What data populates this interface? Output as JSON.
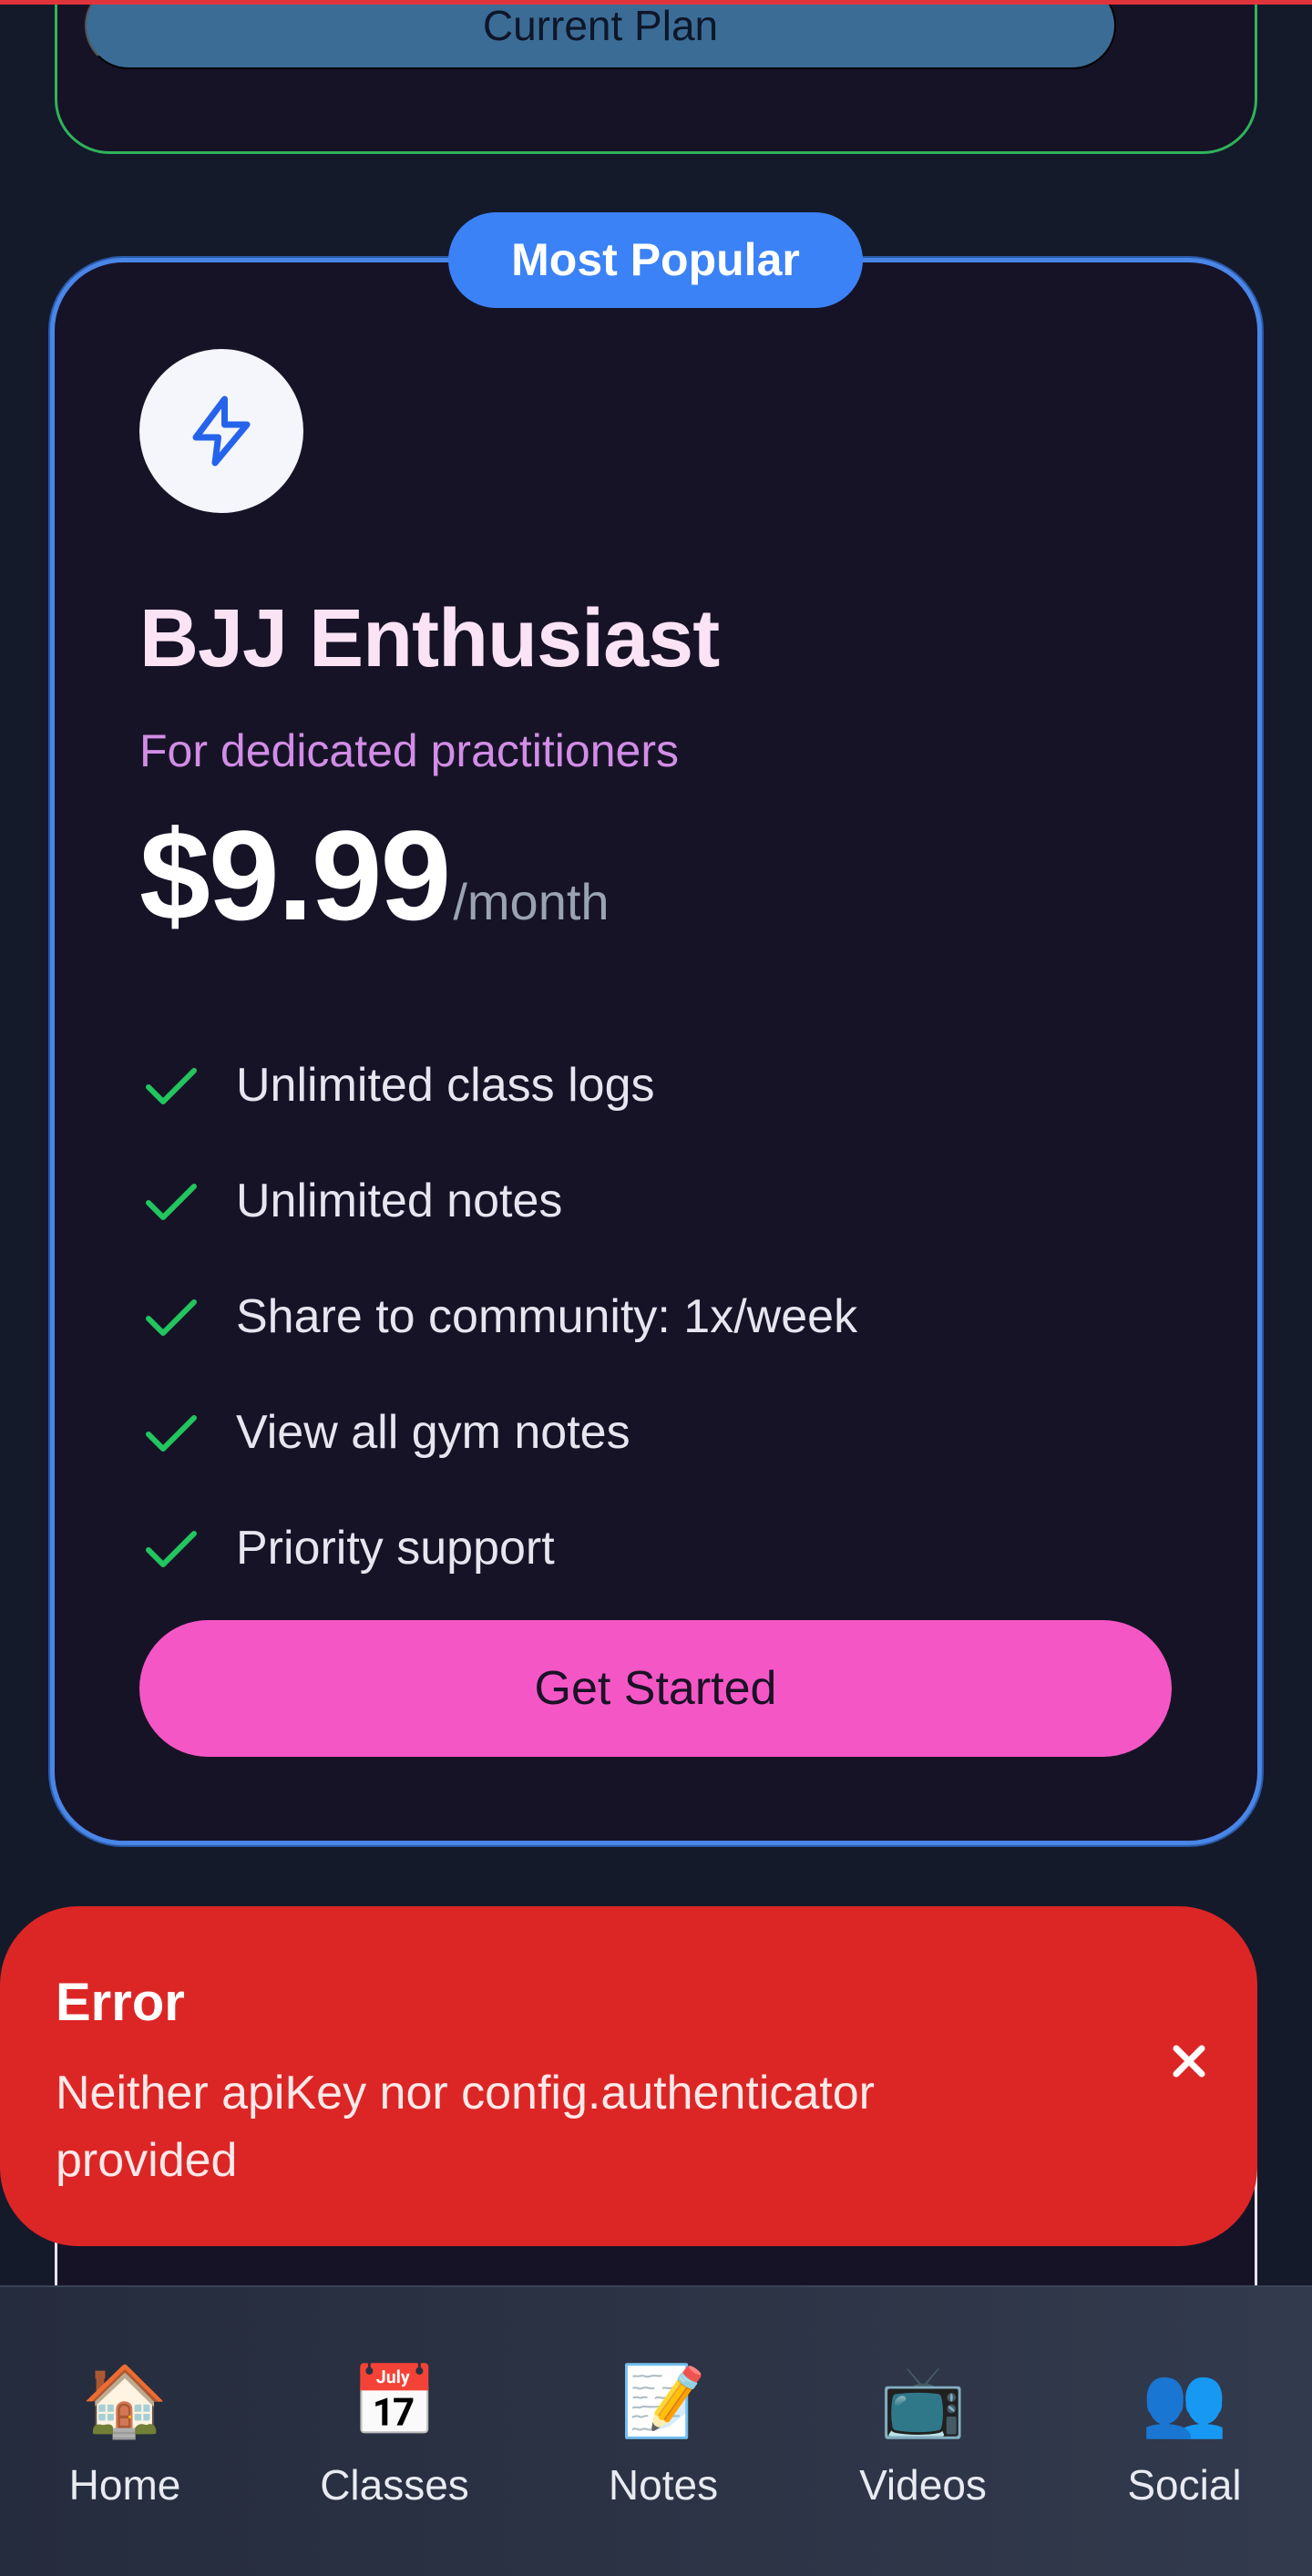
{
  "previous_plan": {
    "button_label": "Current Plan"
  },
  "plan": {
    "badge": "Most Popular",
    "icon": "lightning-bolt-icon",
    "title": "BJJ Enthusiast",
    "subtitle": "For dedicated practitioners",
    "price": "$9.99",
    "period": "/month",
    "features": [
      "Unlimited class logs",
      "Unlimited notes",
      "Share to community: 1x/week",
      "View all gym notes",
      "Priority support"
    ],
    "cta_label": "Get Started"
  },
  "toast": {
    "title": "Error",
    "message": "Neither apiKey nor config.authenticator provided",
    "close_icon": "close-icon"
  },
  "nav": {
    "items": [
      {
        "label": "Home",
        "icon": "🏠",
        "icon_name": "house-icon"
      },
      {
        "label": "Classes",
        "icon": "📅",
        "icon_name": "calendar-icon"
      },
      {
        "label": "Notes",
        "icon": "📝",
        "icon_name": "memo-icon"
      },
      {
        "label": "Videos",
        "icon": "📺",
        "icon_name": "television-icon"
      },
      {
        "label": "Social",
        "icon": "👥",
        "icon_name": "people-icon"
      }
    ]
  },
  "colors": {
    "accent_blue": "#3b82f6",
    "cta_pink": "#f556c6",
    "check_green": "#22c55e",
    "error_red": "#dc2626",
    "card_bg": "#171327",
    "page_bg": "#141a2a"
  }
}
